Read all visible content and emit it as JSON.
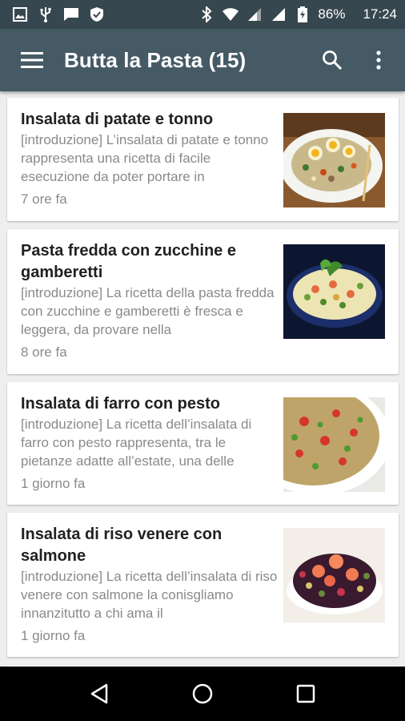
{
  "status_bar": {
    "battery_percent": "86%",
    "time": "17:24",
    "left_icons": [
      "image-icon",
      "usb-icon",
      "message-icon",
      "shield-icon"
    ],
    "right_icons": [
      "bluetooth-icon",
      "wifi-icon",
      "signal-icon",
      "signal-icon",
      "battery-icon"
    ]
  },
  "toolbar": {
    "title": "Butta la Pasta (15)",
    "icons": [
      "menu-icon",
      "search-icon",
      "more-vert-icon"
    ]
  },
  "articles": [
    {
      "title": "Insalata di patate e tonno",
      "intro": "[introduzione] L’insalata di patate e tonno rappresenta una ricetta di facile esecuzione da poter portare in",
      "time": "7 ore fa"
    },
    {
      "title": "Pasta fredda con zucchine e gamberetti",
      "intro": "[introduzione] La ricetta della pasta fredda con zucchine e gamberetti è fresca e leggera, da provare nella",
      "time": "8 ore fa"
    },
    {
      "title": "Insalata di farro con pesto",
      "intro": "[introduzione] La ricetta dell’insalata di farro con pesto rappresenta, tra le pietanze adatte all’estate, una delle",
      "time": "1 giorno fa"
    },
    {
      "title": "Insalata di riso venere con salmone",
      "intro": "[introduzione] La ricetta dell’insalata di riso venere con salmone la conisgliamo innanzitutto a chi ama il",
      "time": "1 giorno fa"
    }
  ],
  "nav_bar": {
    "icons": [
      "back-icon",
      "home-icon",
      "recents-icon"
    ]
  },
  "colors": {
    "status_bar": "#37474f",
    "toolbar": "#455a64",
    "background": "#eeeeee",
    "card": "#ffffff",
    "title_text": "#212121",
    "secondary_text": "#8a8a8a"
  }
}
